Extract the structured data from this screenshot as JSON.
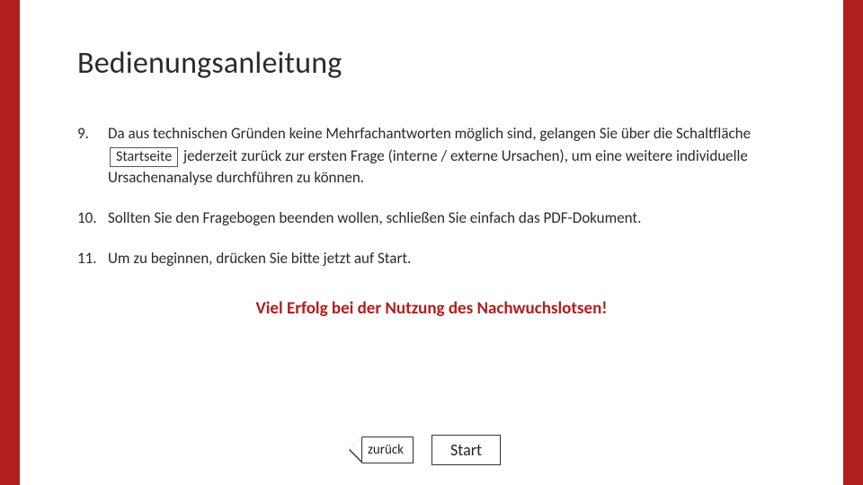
{
  "title": "Bedienungsanleitung",
  "items": [
    {
      "num": "9.",
      "pre": "Da aus technischen Gründen keine Mehrfachantworten möglich sind, gelangen Sie über die Schaltfläche ",
      "btn": "Startseite",
      "post": " jederzeit zurück zur ersten Frage (interne / externe Ursachen), um eine weitere individuelle Ursachenanalyse durchführen zu können."
    },
    {
      "num": "10.",
      "text": "Sollten Sie den Fragebogen beenden wollen, schließen Sie einfach das PDF-Dokument."
    },
    {
      "num": "11.",
      "text": "Um zu beginnen, drücken Sie bitte jetzt auf Start."
    }
  ],
  "success": "Viel Erfolg bei der Nutzung des Nachwuchslotsen!",
  "buttons": {
    "back": "zurück",
    "start": "Start"
  }
}
